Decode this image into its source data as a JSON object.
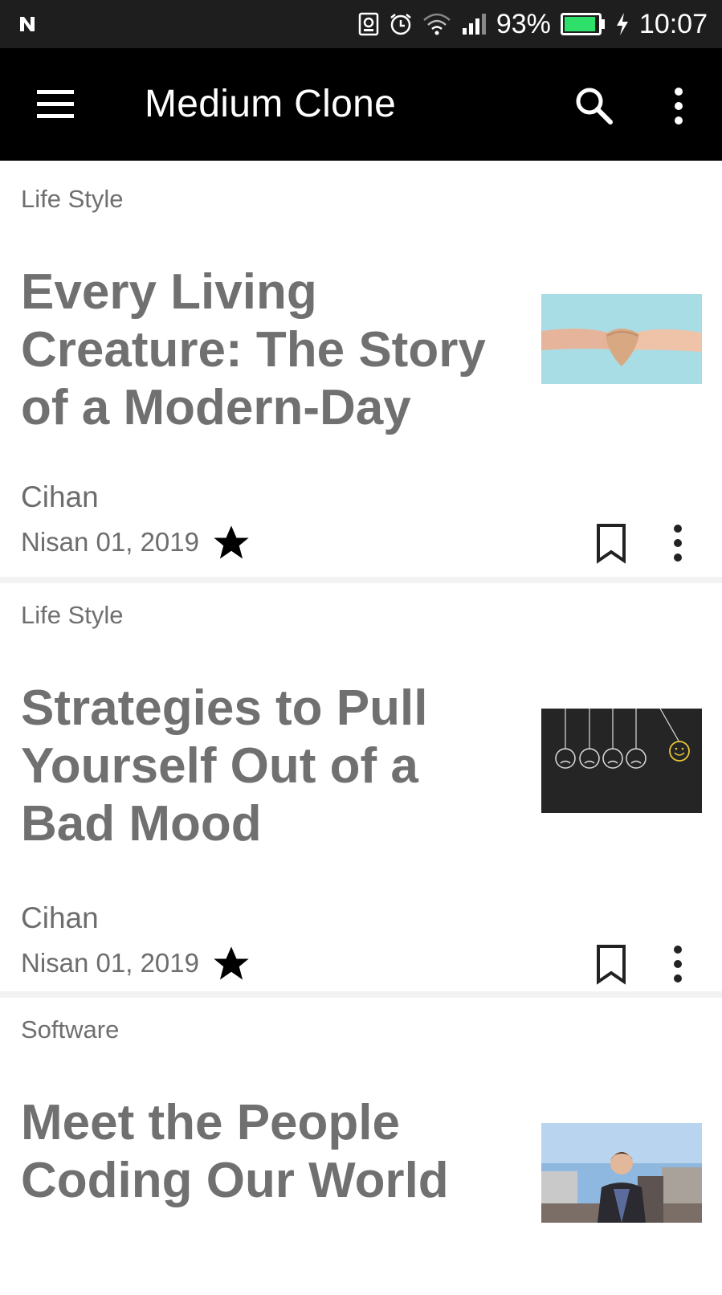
{
  "status_bar": {
    "battery_percent": "93%",
    "time": "10:07",
    "icons": [
      "n-logo-icon",
      "screen-cast-icon",
      "alarm-icon",
      "wifi-icon",
      "cell-signal-icon",
      "battery-icon",
      "charging-bolt-icon"
    ],
    "battery_level": 0.93,
    "battery_color": "#2ee06a"
  },
  "app_bar": {
    "title": "Medium Clone",
    "icons": [
      "menu-icon",
      "search-icon",
      "more-vertical-icon"
    ],
    "background": "#000000"
  },
  "articles": [
    {
      "category": "Life Style",
      "title": "Every Living Creature: The Story of a Modern-Day",
      "author": "Cihan",
      "date": "Nisan 01, 2019",
      "thumbnail": "hands-holding-heart-image"
    },
    {
      "category": "Life Style",
      "title": "Strategies to Pull Yourself Out of a Bad Mood",
      "author": "Cihan",
      "date": "Nisan 01, 2019",
      "thumbnail": "hanging-faces-chalkboard-image"
    },
    {
      "category": "Software",
      "title": "Meet the People Coding Our World",
      "thumbnail": "man-on-rooftop-image"
    }
  ],
  "colors": {
    "text_gray": "#707070",
    "card_divider": "#f2f2f2"
  }
}
